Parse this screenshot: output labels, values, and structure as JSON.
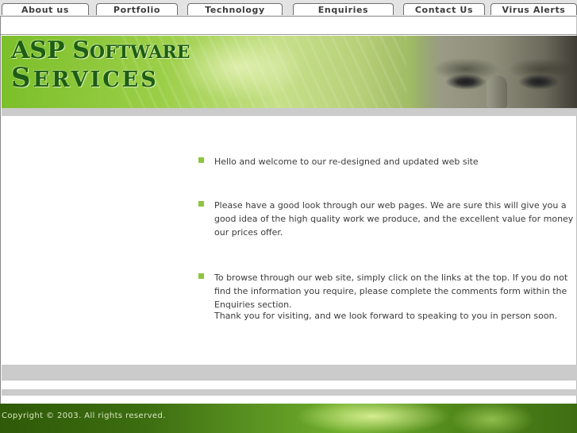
{
  "nav": {
    "tabs": [
      {
        "label": "About us"
      },
      {
        "label": "Portfolio"
      },
      {
        "label": "Technology"
      },
      {
        "label": "Enquiries"
      },
      {
        "label": "Contact Us"
      },
      {
        "label": "Virus Alerts"
      }
    ]
  },
  "banner": {
    "line1_first": "ASP",
    "line1_s": "S",
    "line1_rest": "OFTWARE",
    "line2_s": "S",
    "line2_rest": "ERVICES"
  },
  "content": {
    "items": [
      {
        "text": "Hello and welcome to our re-designed and updated web site"
      },
      {
        "text": "Please have a good look through our web pages. We are sure this will give you a good idea of the high quality work we produce, and the excellent value for money our prices offer."
      },
      {
        "text": "To browse through our web site, simply click on the links at the top. If you do not find the information you require, please complete the comments form within the Enquiries section."
      }
    ],
    "thanks": "Thank you for visiting, and we look forward to speaking to you in person soon."
  },
  "footer": {
    "copyright": "Copyright © 2003. All rights reserved."
  },
  "colors": {
    "accent_green": "#8cc63e",
    "brand_dark_green": "#1d5e14",
    "footer_green": "#3c6d10"
  },
  "icons": {
    "bullet": "green-square-bullet-icon"
  }
}
